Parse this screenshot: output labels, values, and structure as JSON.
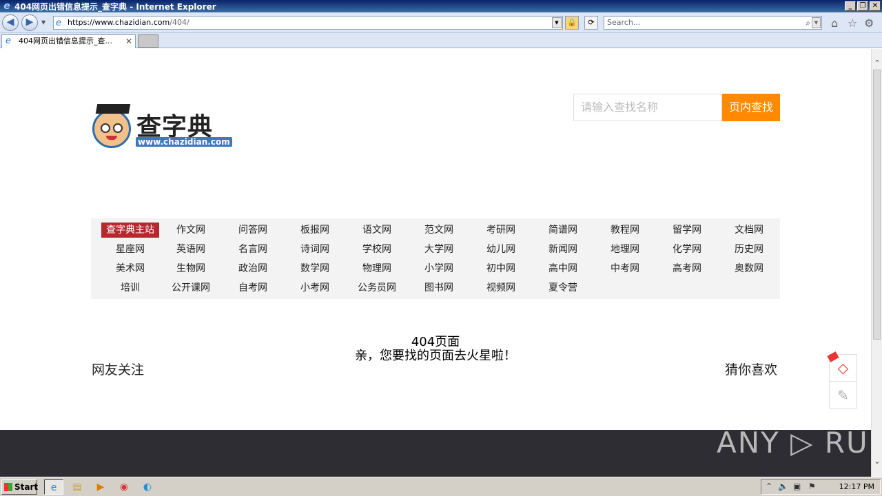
{
  "window": {
    "title": "404网页出错信息提示_查字典 - Internet Explorer"
  },
  "address": {
    "url_host": "https://www.chazidian.com",
    "url_path": "/404/"
  },
  "browser_search": {
    "placeholder": "Search..."
  },
  "tab": {
    "label": "404网页出错信息提示_查..."
  },
  "site": {
    "brand": "查字典",
    "brand_url": "www.chazidian.com",
    "search_placeholder": "请输入查找名称",
    "search_button": "页内查找",
    "nav": [
      "查字典主站",
      "作文网",
      "问答网",
      "板报网",
      "语文网",
      "范文网",
      "考研网",
      "简谱网",
      "教程网",
      "留学网",
      "文档网",
      "星座网",
      "英语网",
      "名言网",
      "诗词网",
      "学校网",
      "大学网",
      "幼儿网",
      "新闻网",
      "地理网",
      "化学网",
      "历史网",
      "美术网",
      "生物网",
      "政治网",
      "数学网",
      "物理网",
      "小学网",
      "初中网",
      "高中网",
      "中考网",
      "高考网",
      "奥数网",
      "培训",
      "公开课网",
      "自考网",
      "小考网",
      "公务员网",
      "图书网",
      "视频网",
      "夏令营"
    ],
    "error_title": "404页面",
    "error_message": "亲，您要找的页面去火星啦！",
    "follow_label": "网友关注",
    "guess_label": "猜你喜欢"
  },
  "watermark": "ANY ▷ RUN",
  "taskbar": {
    "start_label": "Start",
    "clock": "12:17 PM"
  },
  "colors": {
    "accent_orange": "#ff8a00",
    "nav_active": "#b7282e",
    "footer": "#2d2d33"
  }
}
